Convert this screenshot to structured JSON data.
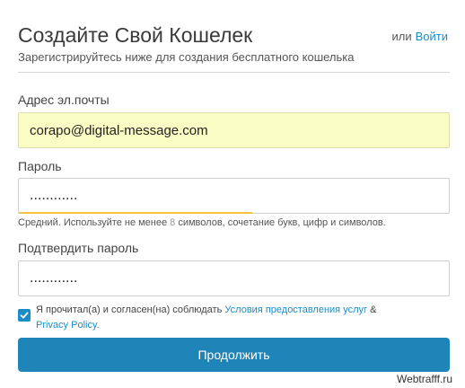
{
  "header": {
    "title": "Создайте Свой Кошелек",
    "subtitle": "Зарегистрируйтесь ниже для создания бесплатного кошелька",
    "login_prefix": "или",
    "login_link": "Войти"
  },
  "form": {
    "email": {
      "label": "Адрес эл.почты",
      "value": "corapo@digital-message.com"
    },
    "password": {
      "label": "Пароль",
      "value": "............",
      "strength_fraction": 0.54,
      "hint_before": "Средний. Используйте не менее ",
      "hint_number": "8",
      "hint_after": " символов, сочетание букв, цифр и символов."
    },
    "confirm": {
      "label": "Подтвердить пароль",
      "value": "............"
    },
    "terms": {
      "checked": true,
      "text": "Я прочитал(а) и согласен(на) соблюдать",
      "link_terms": "Условия предоставления услуг",
      "amp": "&",
      "link_privacy": "Privacy Policy."
    },
    "submit_label": "Продолжить"
  },
  "watermark": "Webtrafff.ru",
  "colors": {
    "accent": "#1a8dc7",
    "button": "#1f84b8",
    "autofill": "#fafdc3",
    "strength": "#f5c242"
  }
}
